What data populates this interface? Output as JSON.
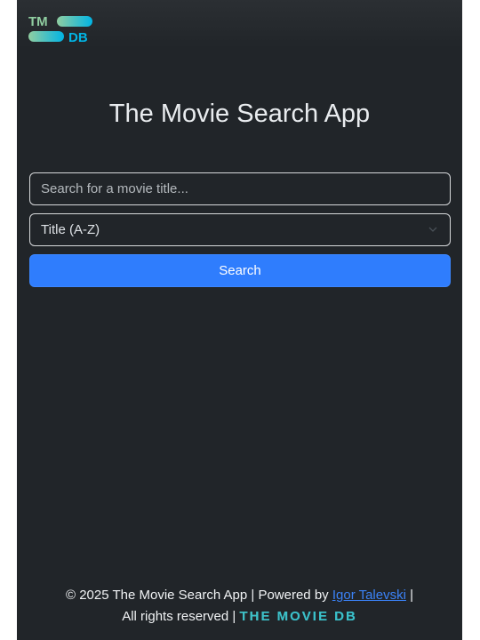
{
  "header": {
    "logo_top": "TM",
    "logo_bottom": "DB"
  },
  "main": {
    "title": "The Movie Search App",
    "search_placeholder": "Search for a movie title...",
    "search_value": "",
    "sort_value": "Title (A-Z)",
    "search_button_label": "Search"
  },
  "footer": {
    "copyright": "© 2025 The Movie Search App | Powered by",
    "author_link": "Igor Talevski",
    "separator": "|",
    "rights": "All rights reserved |",
    "tmdb_wordmark": "THE MOVIE DB"
  },
  "colors": {
    "background": "#212529",
    "accent": "#2f7dfd",
    "link": "#3b82f6",
    "tmdb_green": "#90cea1",
    "tmdb_blue": "#01b4e4"
  }
}
